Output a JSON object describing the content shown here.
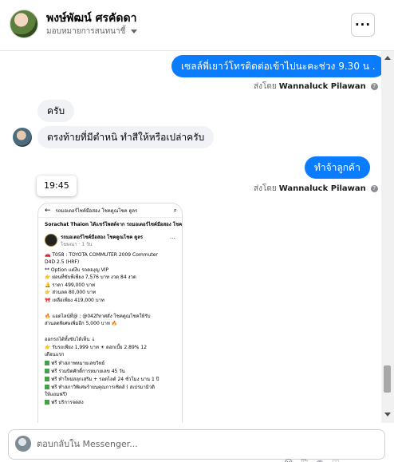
{
  "header": {
    "name": "พงษ์พัฒน์ ศรคัดดา",
    "assign_label": "มอบหมายการสนทนาชี้",
    "more_label": "···"
  },
  "messages": {
    "out_1": "เซลล์พี่เยาว์โทรติดต่อเข้าไปนะคะช่วง 9.30 น .",
    "sent_by_1_prefix": "ส่งโดย",
    "sent_by_1_name": "Wannaluck Pilawan",
    "in_1": "ครับ",
    "in_2": "ตรงท้ายที่มีตำหนิ ทำสีให้หรือเปล่าครับ",
    "out_2": "ทำจ้าลูกค้า",
    "sent_by_2_prefix": "ส่งโดย",
    "sent_by_2_name": "Wannaluck Pilawan",
    "time_tooltip": "19:45"
  },
  "shared_image": {
    "search_query": "รถมอเตอร์ไซค์มือสอง โชคดูณโชค ดูลร",
    "top_caption": "Sorachat Thaion ได้แชร์โพสต์จาก รถมอเตอร์ไซค์มือสอง โชคดูณโชค ดูลร",
    "page_name": "รถมอเตอร์ไซค์มือสอง โชคดูณโชค ดูลร",
    "post_time": "โฆษณา · 1 วัน",
    "lines": [
      "🚗 T058 : TOYOTA COMMUTER 2009 Commuter",
      "D4D 2.5 (HRF)",
      "** Option แต่งีบ รถคองุญ VIP",
      "👉 ผ่อนที่ขับพีเพียง 7,576 บาท งวด 84 งวด",
      "🔔 ราคา 499,000 บาท",
      "👉 ส่วนลด 80,000 บาท",
      "🎀 เหลือเพียง 419,000 บาท",
      "",
      "🔥 แอดไลน์ที่@ : @042fหาศสั่ง โชคดูณโชคให้รับ",
      "ส่วนลดพิเศษเพิ่มอีก 5,000 บาท 🔥",
      "",
      "ออกรถได้ทั้งขับได้เท็น ↓",
      "👉 รับรถเพียง 1,999 บาท ☀ ดอกเบี้ย 2.89% 12",
      "เดือนแรก",
      "ฟรี ทำสภาพหมายเลขวิทย์",
      "ฟรี ร่วมบิดศักดิ์การหมายเลข 45 วัน",
      "ฟรี ทำใหม่สลุกเสริม + รอดไลด์ 24 ชั่วโมง นาน 1 ปี",
      "ฟรี ทำสภาวิพิเศษร้ายนคุณการเซิดส์ ( สเปรมามิวดิ",
      "ให้แถมฟรี)",
      "ฟรี บริการจดส่ง"
    ]
  },
  "composer": {
    "placeholder": "ตอบกลับใน Messenger..."
  },
  "colors": {
    "brand_blue": "#0a7cff",
    "incoming_bubble": "#f0f2f5",
    "secondary_text": "#65676b"
  }
}
